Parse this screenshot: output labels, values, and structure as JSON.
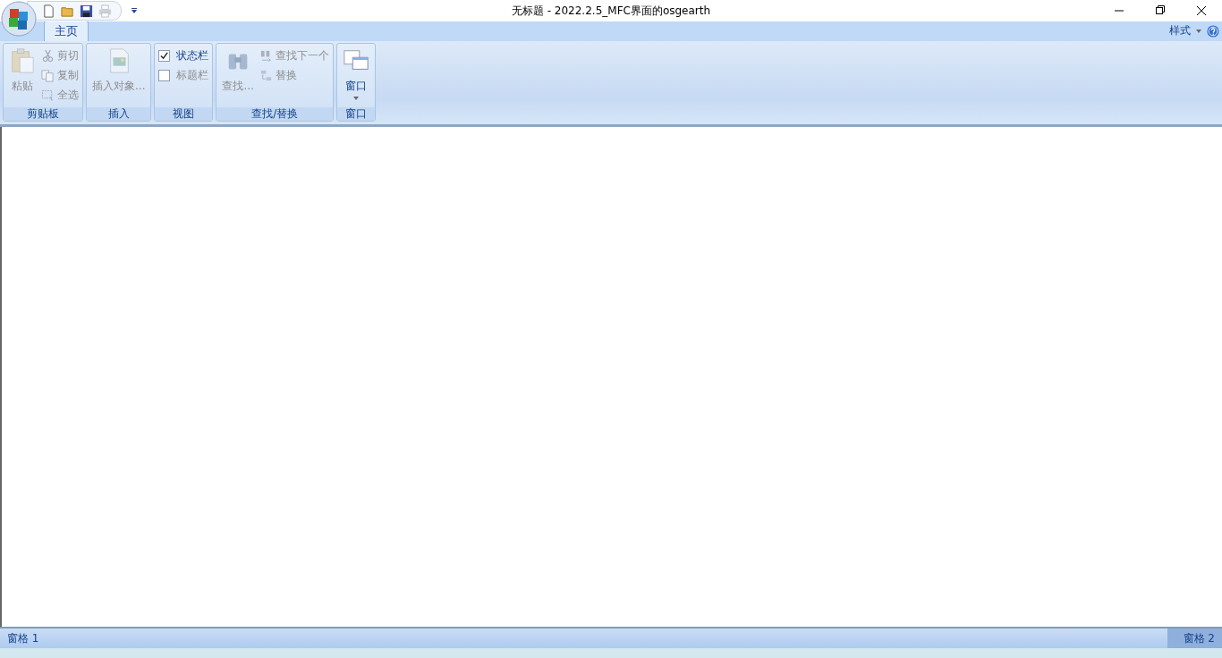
{
  "window": {
    "title": "无标题 - 2022.2.5_MFC界面的osgearth"
  },
  "quick_access": [
    {
      "disabled": false
    },
    {
      "disabled": false
    },
    {
      "disabled": false
    },
    {
      "disabled": true
    }
  ],
  "tabs": [
    {
      "label": "主页",
      "selected": true
    }
  ],
  "style_menu": {
    "label": "样式"
  },
  "groups": [
    {
      "label": "剪贴板",
      "large": {
        "label": "粘贴",
        "disabled": true
      },
      "items": [
        {
          "kind": "button",
          "label": "剪切",
          "disabled": true
        },
        {
          "kind": "button",
          "label": "复制",
          "disabled": true
        },
        {
          "kind": "button",
          "label": "全选",
          "disabled": true
        }
      ]
    },
    {
      "label": "插入",
      "large": {
        "label": "插入对象...",
        "disabled": true
      }
    },
    {
      "label": "视图",
      "items": [
        {
          "kind": "checkbox",
          "label": "状态栏",
          "checked": true,
          "disabled": false
        },
        {
          "kind": "checkbox",
          "label": "标题栏",
          "checked": false,
          "disabled": true
        }
      ]
    },
    {
      "label": "查找/替换",
      "large": {
        "label": "查找...",
        "disabled": true
      },
      "items": [
        {
          "kind": "button",
          "label": "查找下一个",
          "disabled": true
        },
        {
          "kind": "button",
          "label": "替换",
          "disabled": true
        }
      ]
    },
    {
      "label": "窗口",
      "large": {
        "label": "窗口",
        "disabled": false,
        "dropdown": true
      }
    }
  ],
  "status_bar": {
    "left": "窗格 1",
    "right": "窗格 2"
  }
}
